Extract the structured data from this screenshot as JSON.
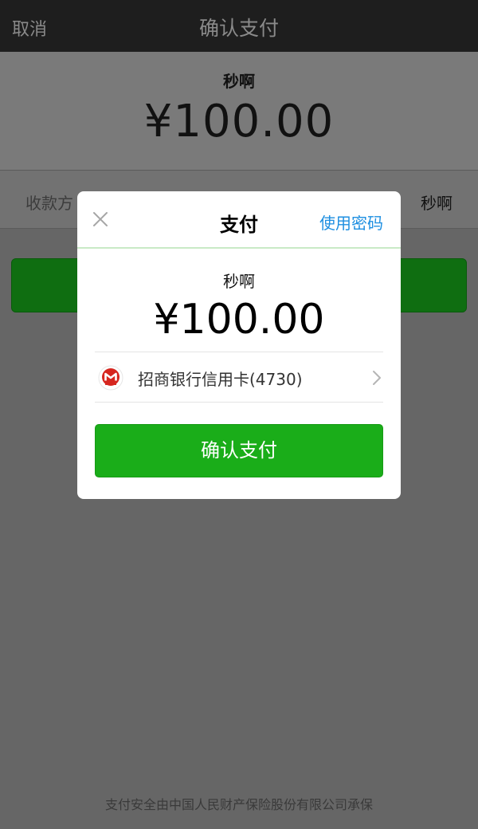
{
  "navbar": {
    "cancel_label": "取消",
    "title": "确认支付"
  },
  "background": {
    "payee": "秒啊",
    "amount": "¥100.00",
    "row_label": "收款方",
    "row_value": "秒啊"
  },
  "modal": {
    "close_icon": "close-icon",
    "title": "支付",
    "use_password_label": "使用密码",
    "payee": "秒啊",
    "amount": "¥100.00",
    "card": {
      "bank_icon": "cmb-bank-logo-icon",
      "label": "招商银行信用卡(4730)",
      "chevron_icon": "chevron-right-icon"
    },
    "confirm_label": "确认支付"
  },
  "footer": {
    "note": "支付安全由中国人民财产保险股份有限公司承保"
  },
  "colors": {
    "primary_green": "#1aad19",
    "link_blue": "#1e8fe1",
    "bank_red": "#d6261f"
  }
}
